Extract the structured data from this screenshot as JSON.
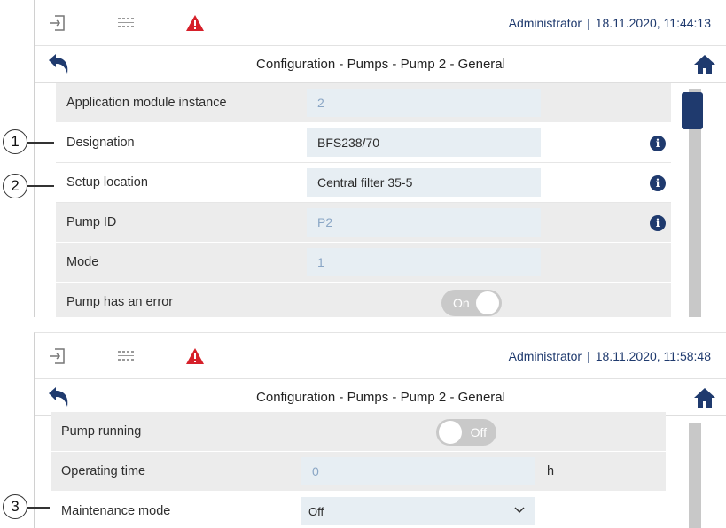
{
  "screen1": {
    "status": {
      "user": "Administrator",
      "datetime": "18.11.2020, 11:44:13"
    },
    "title": "Configuration - Pumps - Pump 2 - General",
    "rows": [
      {
        "label": "Application module instance",
        "value": "2"
      },
      {
        "label": "Designation",
        "value": "BFS238/70"
      },
      {
        "label": "Setup location",
        "value": "Central filter 35-5"
      },
      {
        "label": "Pump ID",
        "value": "P2"
      },
      {
        "label": "Mode",
        "value": "1"
      },
      {
        "label": "Pump has an error",
        "toggle": "On"
      }
    ]
  },
  "screen2": {
    "status": {
      "user": "Administrator",
      "datetime": "18.11.2020, 11:58:48"
    },
    "title": "Configuration - Pumps - Pump 2 - General",
    "rows": [
      {
        "label": "Pump running",
        "toggle": "Off"
      },
      {
        "label": "Operating time",
        "value": "0",
        "unit": "h"
      },
      {
        "label": "Maintenance mode",
        "selected": "Off"
      }
    ]
  },
  "callouts": [
    "1",
    "2",
    "3"
  ],
  "icons": [
    "login-icon",
    "keypad-icon",
    "warning-icon",
    "back-arrow-icon",
    "home-icon",
    "info-icon",
    "chevron-down-icon"
  ],
  "colors": {
    "accent": "#1f3a6e",
    "warning": "#d6202a",
    "field_bg": "#e7eef3",
    "row_bg": "#ececec"
  }
}
